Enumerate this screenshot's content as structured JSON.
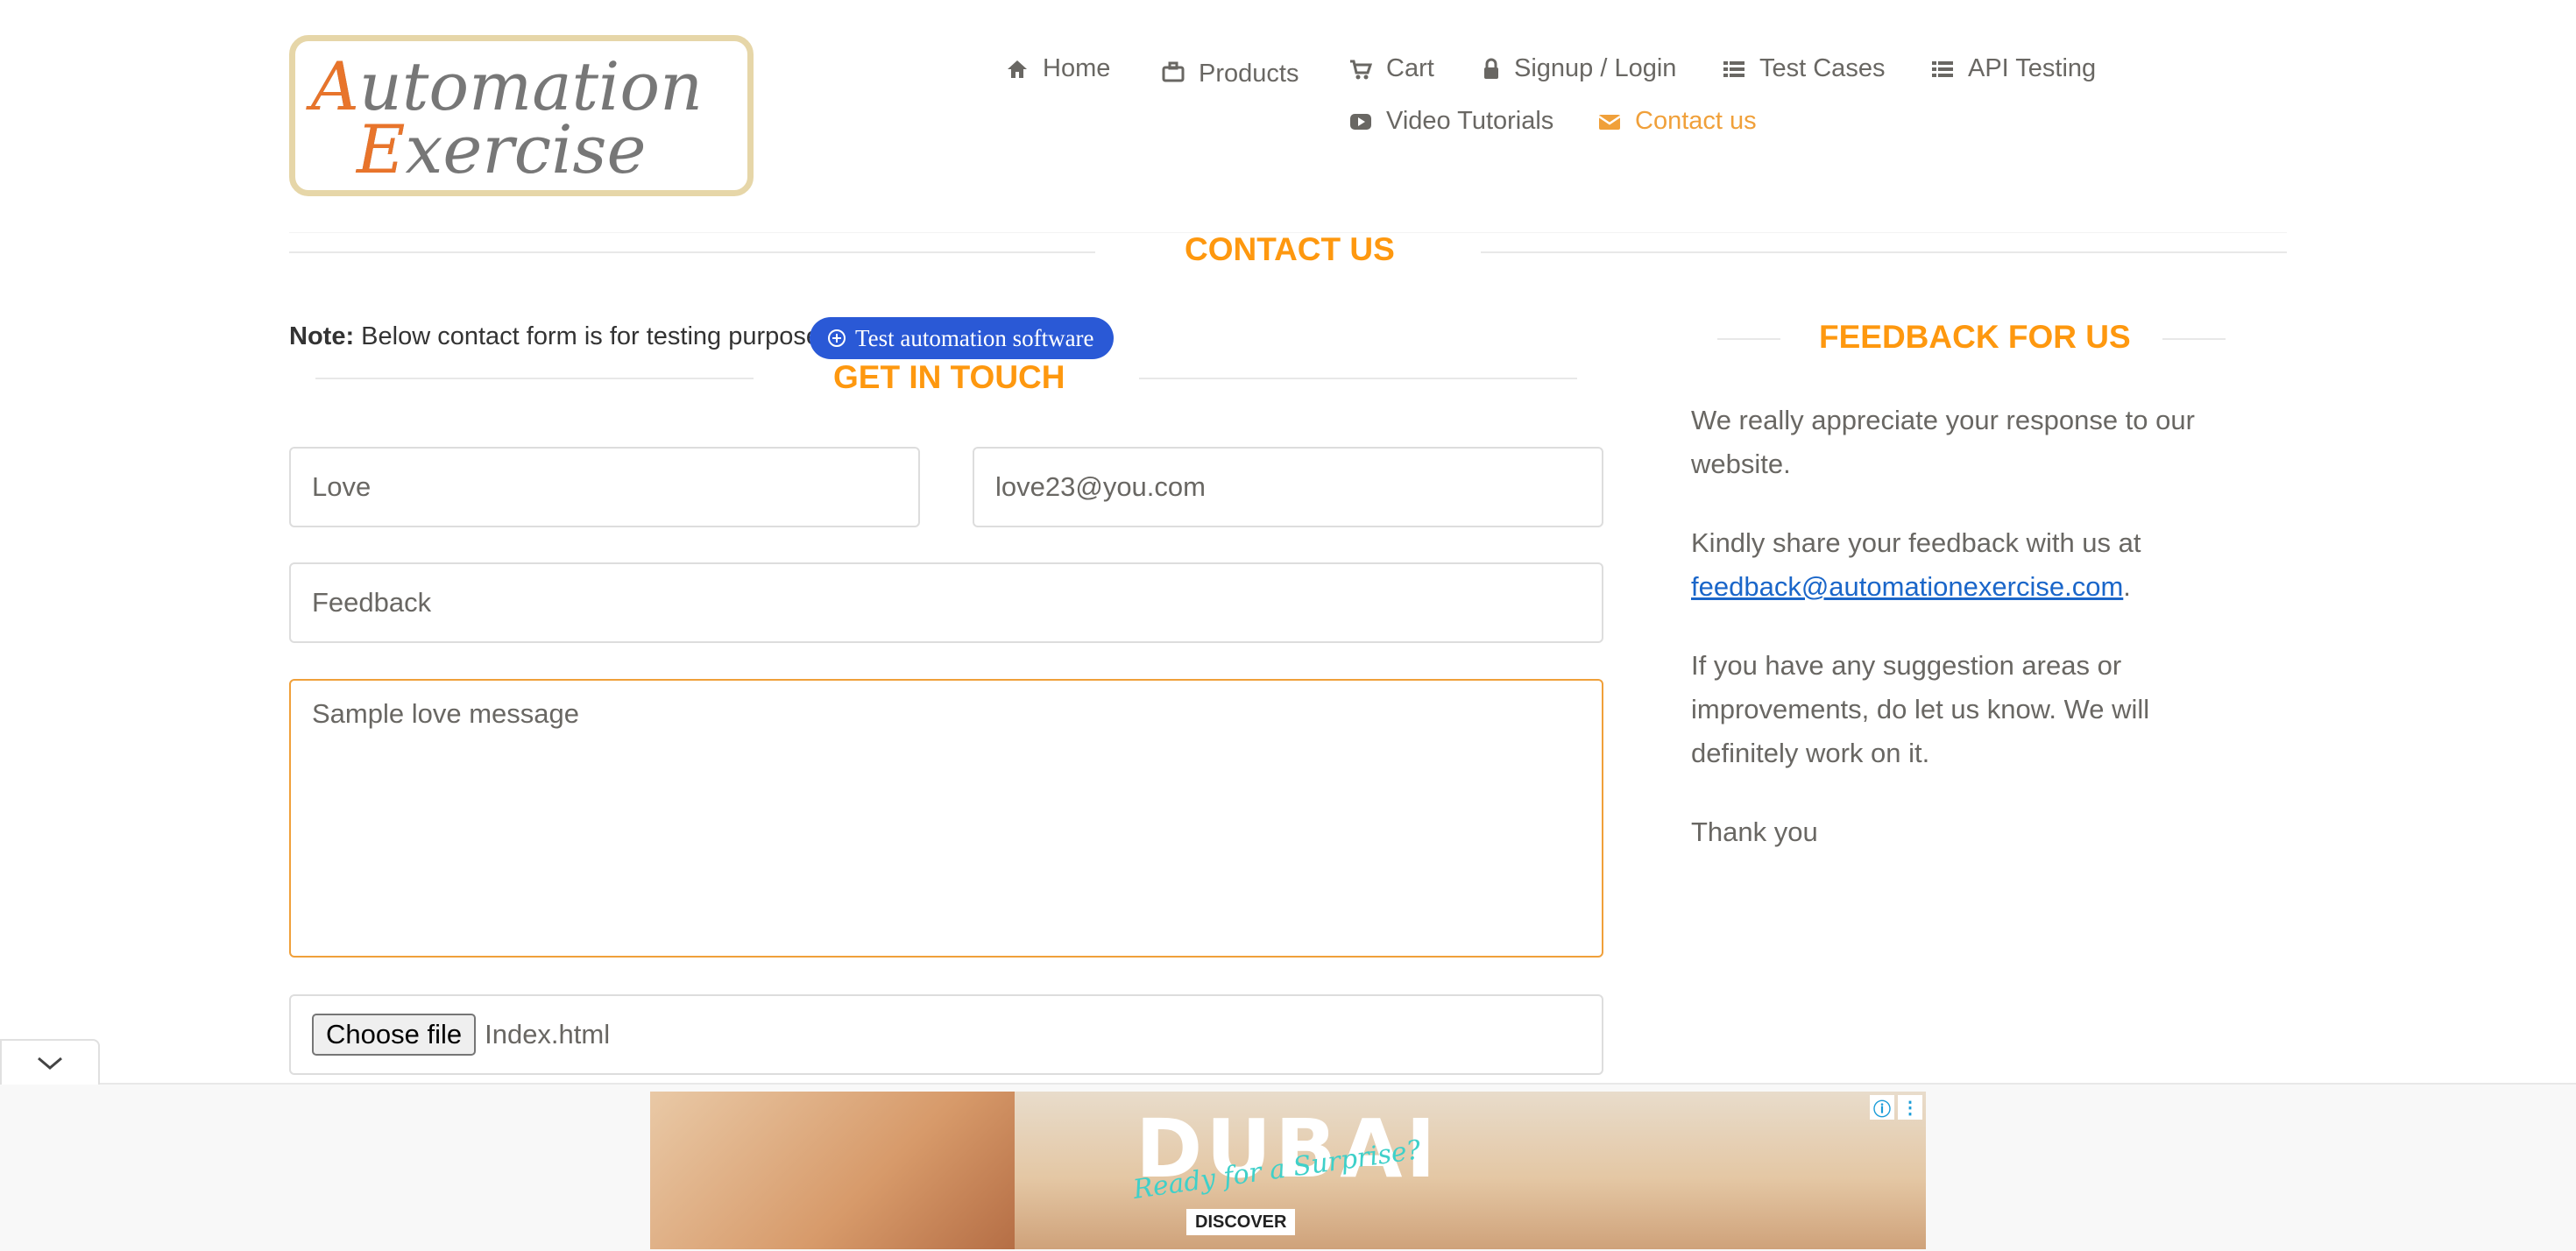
{
  "logo": {
    "line1": "Automation",
    "line2": "Exercise"
  },
  "nav": [
    {
      "label": "Home",
      "icon": "home-icon"
    },
    {
      "label": "Products",
      "icon": "briefcase-icon"
    },
    {
      "label": "Cart",
      "icon": "cart-icon"
    },
    {
      "label": "Signup / Login",
      "icon": "lock-icon"
    },
    {
      "label": "Test Cases",
      "icon": "list-icon"
    },
    {
      "label": "API Testing",
      "icon": "list-icon"
    },
    {
      "label": "Video Tutorials",
      "icon": "youtube-icon"
    },
    {
      "label": "Contact us",
      "icon": "envelope-icon",
      "active": true
    }
  ],
  "page_title": "Contact Us",
  "note": {
    "label": "Note:",
    "text": " Below contact form is for testing purpose."
  },
  "badge": {
    "label": "Test automation software"
  },
  "form": {
    "heading": "Get In Touch",
    "name_value": "Love",
    "email_value": "love23@you.com",
    "subject_value": "Feedback",
    "message_value": "Sample love message",
    "file_button": "Choose file",
    "file_name": "Index.html"
  },
  "feedback": {
    "heading": "Feedback For Us",
    "p1": "We really appreciate your response to our website.",
    "p2_prefix": "Kindly share your feedback with us at ",
    "p2_link": "feedback@automationexercise.com",
    "p2_suffix": ".",
    "p3": "If you have any suggestion areas or improvements, do let us know. We will definitely work on it.",
    "p4": "Thank you"
  },
  "ad": {
    "brand": "DUBAI",
    "tagline": "Ready for a Surprise?",
    "cta": "DISCOVER"
  },
  "colors": {
    "accent": "#fe980f",
    "active_nav": "#f0a03a",
    "badge": "#2a59d6",
    "link": "#1a66c9"
  }
}
